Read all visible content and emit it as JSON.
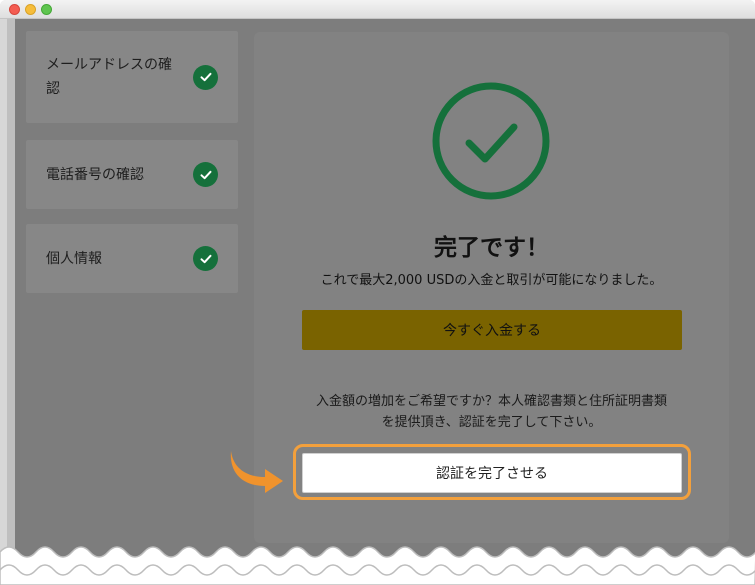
{
  "steps": [
    {
      "line1": "メールアドレスの確",
      "line2": "認"
    },
    {
      "label": "電話番号の確認"
    },
    {
      "label": "個人情報"
    }
  ],
  "panel": {
    "title": "完了です！",
    "subtitle": "これで最大2,000 USDの入金と取引が可能になりました。",
    "deposit_button": "今すぐ入金する",
    "info_line1": "入金額の増加をご希望ですか？本人確認書類と住所証明書類",
    "info_line2": "を提供頂き、認証を完了して下さい。",
    "verify_button": "認証を完了させる"
  },
  "colors": {
    "check_green": "#15703b",
    "deposit_button": "#7a6300",
    "highlight_orange": "#f3a03c",
    "arrow_orange": "#f0932d"
  },
  "icons": [
    "check-circle-icon",
    "pointer-arrow-icon"
  ]
}
